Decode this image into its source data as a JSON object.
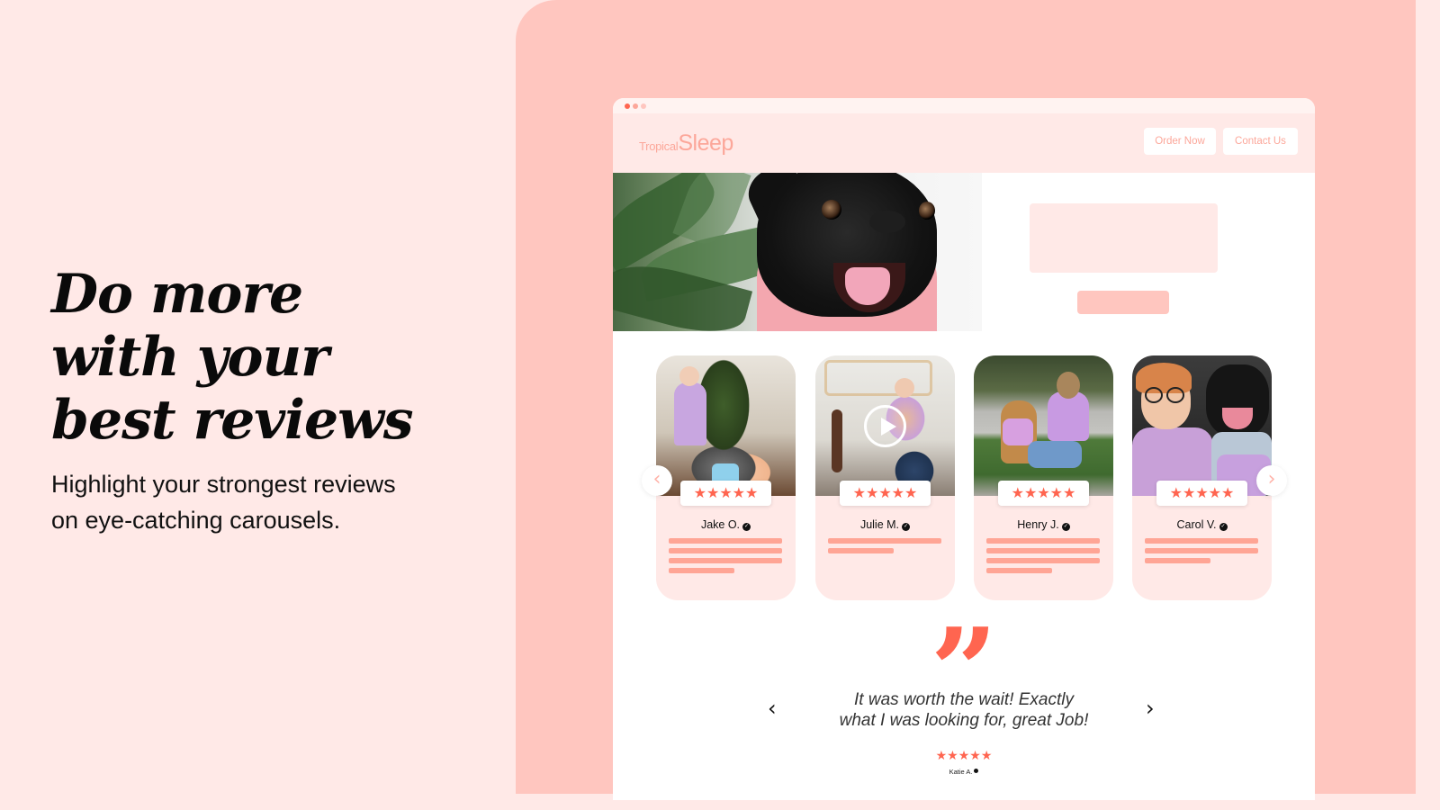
{
  "hero": {
    "title_lines": [
      "Do more",
      "with your",
      "best reviews"
    ],
    "subtitle_lines": [
      "Highlight your strongest reviews",
      "on eye-catching carousels."
    ]
  },
  "colors": {
    "page_bg": "#FFE9E7",
    "panel_bg": "#FFC6BF",
    "accent": "#FF6550",
    "logo": "#FCA79A",
    "text_line": "#FFA595",
    "window_dots": [
      "#FF6550",
      "#FCA79A",
      "#FFC6BF"
    ]
  },
  "site": {
    "logo_small": "Tropical",
    "logo_big": "Sleep",
    "nav": {
      "order_now": "Order Now",
      "contact_us": "Contact Us"
    },
    "hero_image": "french-bulldog-in-pink-hoodie-photo"
  },
  "carousel": {
    "prev_icon": "‹",
    "next_icon": "›",
    "cards": [
      {
        "name": "Jake O.",
        "rating": 5,
        "stars": "★★★★★",
        "verified": true,
        "media": "photo",
        "photo": "woman-and-dog-christmas-tree",
        "text_lines": 4
      },
      {
        "name": "Julie M.",
        "rating": 5,
        "stars": "★★★★★",
        "verified": true,
        "media": "video",
        "photo": "woman-with-dog-living-room",
        "text_lines": 2
      },
      {
        "name": "Henry J.",
        "rating": 5,
        "stars": "★★★★★",
        "verified": true,
        "media": "photo",
        "photo": "woman-with-golden-retriever-outdoors",
        "text_lines": 4
      },
      {
        "name": "Carol V.",
        "rating": 5,
        "stars": "★★★★★",
        "verified": true,
        "media": "photo",
        "photo": "selfie-woman-with-dog",
        "text_lines": 3
      }
    ]
  },
  "testimonial": {
    "quote_icon": "”",
    "lines": [
      "It was worth the wait! Exactly",
      "what I was looking for, great Job!"
    ],
    "rating": 5,
    "stars": "★★★★★",
    "author": "Katie A.",
    "prev_icon": "‹",
    "next_icon": "›"
  }
}
